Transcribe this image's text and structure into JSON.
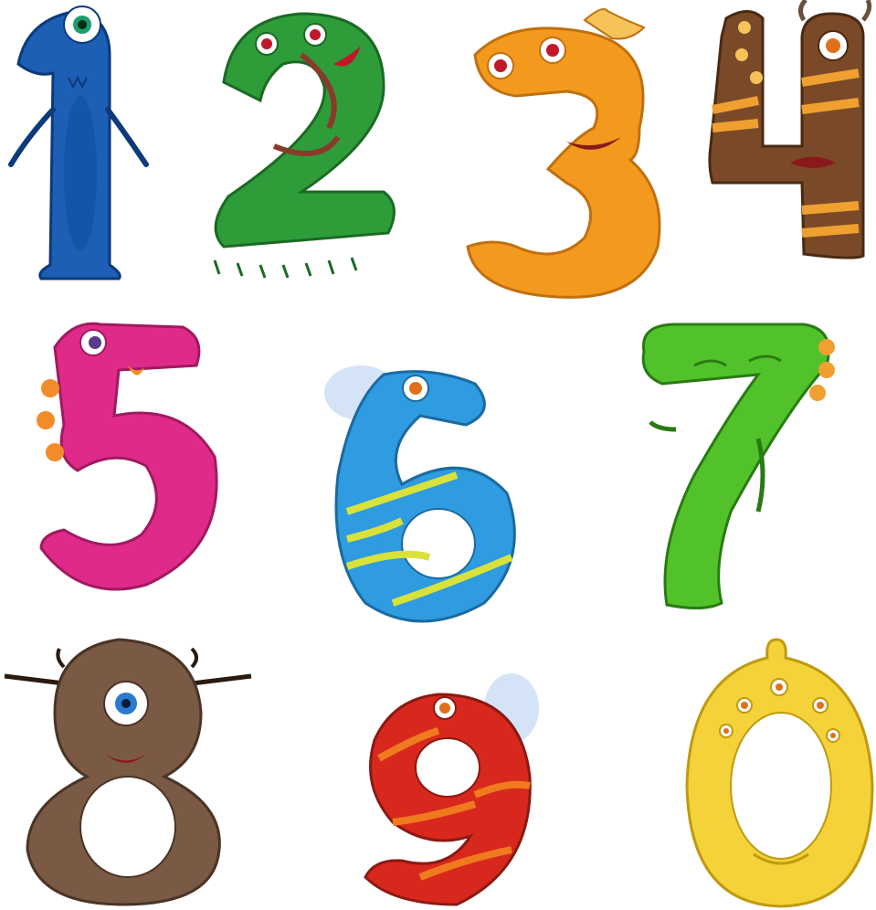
{
  "monsters": [
    {
      "digit": "1",
      "color": "#1d5fb5",
      "accent": "#0f3f8a",
      "eye": "cyclops"
    },
    {
      "digit": "2",
      "color": "#2f9c3a",
      "accent": "#8a3a2a",
      "eye": "two"
    },
    {
      "digit": "3",
      "color": "#f39a1e",
      "accent": "#f7c25a",
      "eye": "two"
    },
    {
      "digit": "4",
      "color": "#7a4a28",
      "accent": "#f0a030",
      "eye": "many"
    },
    {
      "digit": "5",
      "color": "#e02a8a",
      "accent": "#f28c2a",
      "eye": "one"
    },
    {
      "digit": "6",
      "color": "#2f9be0",
      "accent": "#d8e23a",
      "eye": "one"
    },
    {
      "digit": "7",
      "color": "#52c22a",
      "accent": "#f0a030",
      "eye": "closed"
    },
    {
      "digit": "8",
      "color": "#7a5a44",
      "accent": "#4a3426",
      "eye": "cyclops"
    },
    {
      "digit": "9",
      "color": "#d8281e",
      "accent": "#f07a1e",
      "eye": "one"
    },
    {
      "digit": "0",
      "color": "#f3d23a",
      "accent": "#e0b020",
      "eye": "many"
    }
  ]
}
